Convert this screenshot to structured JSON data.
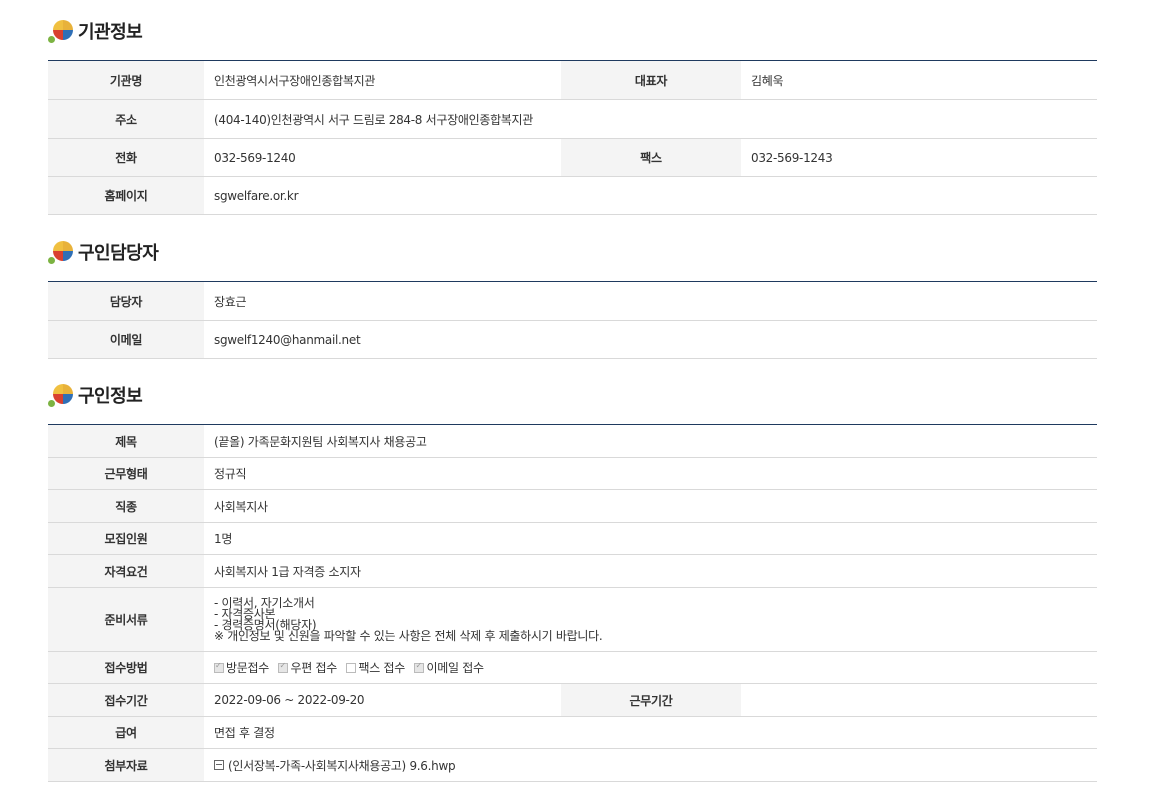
{
  "sections": {
    "org": "기관정보",
    "contact": "구인담당자",
    "job": "구인정보"
  },
  "org": {
    "name_label": "기관명",
    "name": "인천광역시서구장애인종합복지관",
    "rep_label": "대표자",
    "rep": "김혜욱",
    "address_label": "주소",
    "address": "(404-140)인천광역시 서구 드림로 284-8 서구장애인종합복지관",
    "phone_label": "전화",
    "phone": "032-569-1240",
    "fax_label": "팩스",
    "fax": "032-569-1243",
    "homepage_label": "홈페이지",
    "homepage": "sgwelfare.or.kr"
  },
  "contact": {
    "person_label": "담당자",
    "person": "장효근",
    "email_label": "이메일",
    "email": "sgwelf1240@hanmail.net"
  },
  "job": {
    "title_label": "제목",
    "title": "(끝올) 가족문화지원팀 사회복지사 채용공고",
    "type_label": "근무형태",
    "type": "정규직",
    "occupation_label": "직종",
    "occupation": "사회복지사",
    "headcount_label": "모집인원",
    "headcount": "1명",
    "qualification_label": "자격요건",
    "qualification": "사회복지사 1급 자격증 소지자",
    "documents_label": "준비서류",
    "documents": [
      "- 이력서, 자기소개서",
      "- 자격증사본",
      "- 경력증명서(해당자)",
      "※ 개인정보 및 신원을 파악할 수 있는 사항은 전체 삭제 후 제출하시기 바랍니다."
    ],
    "method_label": "접수방법",
    "methods": [
      {
        "label": "방문접수",
        "checked": true
      },
      {
        "label": "우편 접수",
        "checked": true
      },
      {
        "label": "팩스 접수",
        "checked": false
      },
      {
        "label": "이메일 접수",
        "checked": true
      }
    ],
    "period_label": "접수기간",
    "period": "2022-09-06 ~ 2022-09-20",
    "work_period_label": "근무기간",
    "work_period": "",
    "salary_label": "급여",
    "salary": "면접 후 결정",
    "attachment_label": "첨부자료",
    "attachment": "(인서장복-가족-사회복지사채용공고) 9.6.hwp"
  }
}
